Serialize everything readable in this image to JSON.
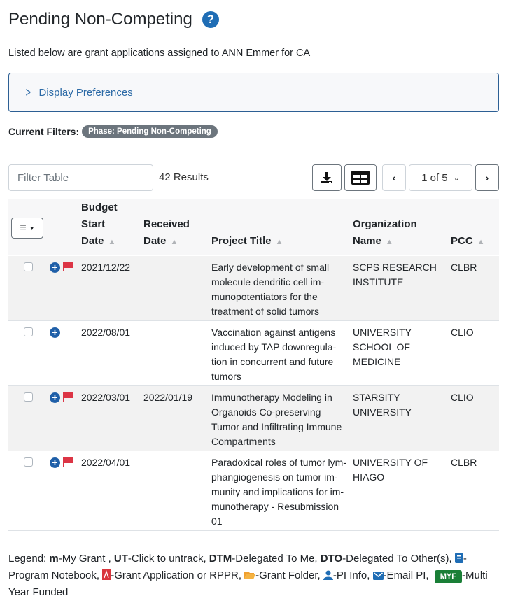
{
  "header": {
    "title": "Pending Non-Competing",
    "subtitle": "Listed below are grant applications assigned to ANN Emmer for CA"
  },
  "display_preferences": {
    "label": "Display Preferences"
  },
  "filters": {
    "label": "Current Filters:",
    "badges": [
      "Phase: Pending Non-Competing"
    ]
  },
  "toolbar": {
    "filter_placeholder": "Filter Table",
    "results": "42 Results",
    "page_select": "1 of 5"
  },
  "table": {
    "columns": {
      "budget_start": [
        "Budget",
        "Start",
        "Date"
      ],
      "received": [
        "Received",
        "Date"
      ],
      "title": "Project Title",
      "org": [
        "Organization",
        "Name"
      ],
      "pcc": "PCC"
    },
    "rows": [
      {
        "flagged": true,
        "budget_start": "2021/12/22",
        "received": "",
        "title": [
          "Early development of small",
          "molecule dendritic cell im-",
          "munopotentiators for the",
          "treatment of solid tumors"
        ],
        "org": [
          "SCPS RESEARCH",
          "INSTITUTE"
        ],
        "pcc": "CLBR"
      },
      {
        "flagged": false,
        "budget_start": "2022/08/01",
        "received": "",
        "title": [
          "Vaccination against antigens",
          "induced by TAP downregula-",
          "tion in concurrent and future",
          "tumors"
        ],
        "org": [
          "UNIVERSITY",
          "SCHOOL OF",
          "MEDICINE"
        ],
        "pcc": "CLIO"
      },
      {
        "flagged": true,
        "budget_start": "2022/03/01",
        "received": "2022/01/19",
        "title": [
          "Immunotherapy Modeling in",
          "Organoids Co-preserving",
          "Tumor and Infiltrating Immune",
          "Compartments"
        ],
        "org": [
          "STARSITY",
          "UNIVERSITY"
        ],
        "pcc": "CLIO"
      },
      {
        "flagged": true,
        "budget_start": "2022/04/01",
        "received": "",
        "title": [
          "Paradoxical roles of tumor lym-",
          "phangiogenesis on tumor im-",
          "munity and implications for im-",
          "munotherapy - Resubmission",
          "01"
        ],
        "org": [
          "UNIVERSITY OF",
          "HIAGO"
        ],
        "pcc": "CLBR"
      }
    ]
  },
  "legend": {
    "prefix": "Legend: ",
    "m": "m",
    "m_desc": "-My Grant , ",
    "ut": "UT",
    "ut_desc": "-Click to untrack, ",
    "dtm": "DTM",
    "dtm_desc": "-Delegated To Me, ",
    "dto": "DTO",
    "dto_desc": "-Delegated To Other(s), ",
    "notebook_desc": "-Program Notebook, ",
    "pdf_desc": "-Grant Application or RPPR, ",
    "folder_desc": "-Grant Folder, ",
    "pi_desc": "-PI Info, ",
    "email_desc": "-Email PI, ",
    "myf": "MYF",
    "myf_desc": "-Multi Year Funded"
  },
  "colors": {
    "accent": "#1f6db5",
    "flag": "#dc3545",
    "badge": "#6c757d",
    "myf": "#1a7f37"
  }
}
